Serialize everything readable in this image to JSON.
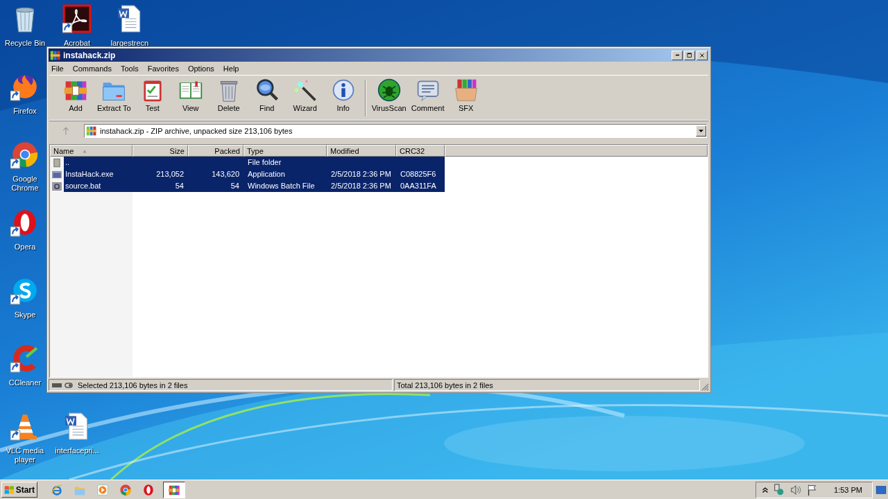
{
  "desktop": {
    "icons": [
      {
        "kind": "recycle",
        "label": "Recycle Bin",
        "shortcut": false
      },
      {
        "kind": "acrobat",
        "label": "Acrobat",
        "shortcut": true
      },
      {
        "kind": "word",
        "label": "largestrecn",
        "shortcut": false
      },
      {
        "kind": "firefox",
        "label": "Firefox",
        "shortcut": true
      },
      {
        "kind": "chrome",
        "label": "Google Chrome",
        "shortcut": true
      },
      {
        "kind": "opera",
        "label": "Opera",
        "shortcut": true
      },
      {
        "kind": "skype",
        "label": "Skype",
        "shortcut": true
      },
      {
        "kind": "ccleaner",
        "label": "CCleaner",
        "shortcut": true
      },
      {
        "kind": "vlc",
        "label": "VLC media player",
        "shortcut": true
      },
      {
        "kind": "word",
        "label": "interfacepri...",
        "shortcut": false
      }
    ]
  },
  "window": {
    "title": "instahack.zip",
    "menu": [
      "File",
      "Commands",
      "Tools",
      "Favorites",
      "Options",
      "Help"
    ],
    "toolbar_groups": [
      [
        {
          "kind": "add",
          "label": "Add"
        },
        {
          "kind": "extract",
          "label": "Extract To"
        },
        {
          "kind": "test",
          "label": "Test"
        },
        {
          "kind": "view",
          "label": "View"
        },
        {
          "kind": "delete",
          "label": "Delete"
        },
        {
          "kind": "find",
          "label": "Find"
        },
        {
          "kind": "wizard",
          "label": "Wizard"
        },
        {
          "kind": "info",
          "label": "Info"
        }
      ],
      [
        {
          "kind": "virusscan",
          "label": "VirusScan"
        },
        {
          "kind": "comment",
          "label": "Comment"
        },
        {
          "kind": "sfx",
          "label": "SFX"
        }
      ]
    ],
    "address": "instahack.zip - ZIP archive, unpacked size 213,106 bytes",
    "columns": [
      {
        "label": "Name",
        "sorted": true
      },
      {
        "label": "Size",
        "sorted": false
      },
      {
        "label": "Packed",
        "sorted": false
      },
      {
        "label": "Type",
        "sorted": false
      },
      {
        "label": "Modified",
        "sorted": false
      },
      {
        "label": "CRC32",
        "sorted": false
      }
    ],
    "rows": [
      {
        "kind": "folder",
        "name": "..",
        "size": "",
        "packed": "",
        "type": "File folder",
        "modified": "",
        "crc32": "",
        "selected": true
      },
      {
        "kind": "exe",
        "name": "InstaHack.exe",
        "size": "213,052",
        "packed": "143,620",
        "type": "Application",
        "modified": "2/5/2018 2:36 PM",
        "crc32": "C08825F6",
        "selected": true
      },
      {
        "kind": "bat",
        "name": "source.bat",
        "size": "54",
        "packed": "54",
        "type": "Windows Batch File",
        "modified": "2/5/2018 2:36 PM",
        "crc32": "0AA311FA",
        "selected": true
      }
    ],
    "status_bar": {
      "left": "Selected 213,106 bytes in 2 files",
      "right": "Total 213,106 bytes in 2 files"
    }
  },
  "taskbar": {
    "start": "Start",
    "apps": [
      {
        "kind": "ie",
        "active": false
      },
      {
        "kind": "explorer",
        "active": false
      },
      {
        "kind": "media",
        "active": false
      },
      {
        "kind": "chrome",
        "active": false
      },
      {
        "kind": "opera",
        "active": false
      },
      {
        "kind": "winrar",
        "active": true
      }
    ],
    "clock": "1:53 PM"
  }
}
